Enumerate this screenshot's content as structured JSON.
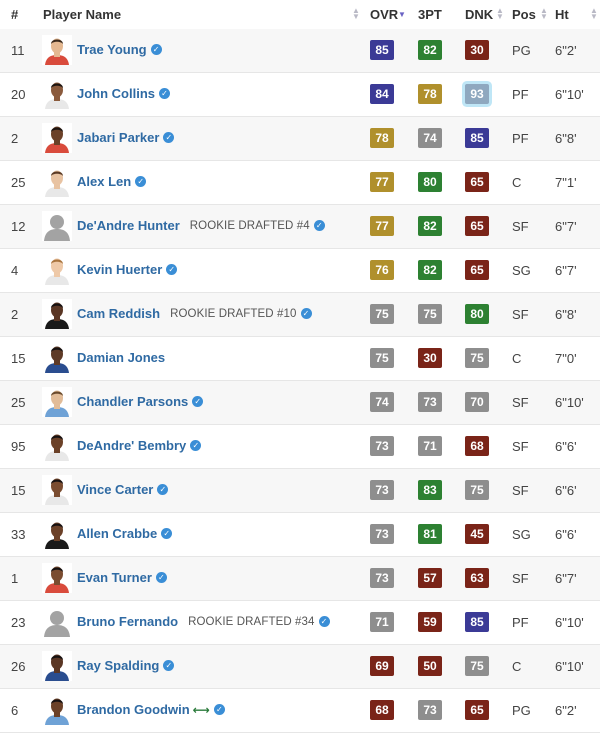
{
  "headers": {
    "num": "#",
    "player": "Player Name",
    "ovr": "OVR",
    "three": "3PT",
    "dnk": "DNK",
    "pos": "Pos",
    "ht": "Ht"
  },
  "colors": {
    "blue": "#3b3a96",
    "green": "#2d8132",
    "gold": "#b0902c",
    "gray": "#8e8e8e",
    "brown": "#7a2418",
    "link": "#2f6aa3"
  },
  "players": [
    {
      "num": "11",
      "name": "Trae Young",
      "rookie": "",
      "ovr": 85,
      "ovr_c": "blue",
      "tpt": 82,
      "tpt_c": "green",
      "dnk": 30,
      "dnk_c": "brown",
      "pos": "PG",
      "ht": "6\"2'",
      "avatar": "photo",
      "skin": "#e4b891",
      "hair": "#3b2a1c",
      "jersey": "#d94b3c",
      "icon": "verified-icon"
    },
    {
      "num": "20",
      "name": "John Collins",
      "rookie": "",
      "ovr": 84,
      "ovr_c": "blue",
      "tpt": 78,
      "tpt_c": "gold",
      "dnk": 93,
      "dnk_c": "hl",
      "pos": "PF",
      "ht": "6\"10'",
      "avatar": "photo",
      "skin": "#8a5a3c",
      "hair": "#1c1410",
      "jersey": "#e8e8e8",
      "icon": "verified-icon"
    },
    {
      "num": "2",
      "name": "Jabari Parker",
      "rookie": "",
      "ovr": 78,
      "ovr_c": "gold",
      "tpt": 74,
      "tpt_c": "gray",
      "dnk": 85,
      "dnk_c": "blue",
      "pos": "PF",
      "ht": "6\"8'",
      "avatar": "photo",
      "skin": "#6b4128",
      "hair": "#1c1410",
      "jersey": "#d94b3c",
      "icon": "verified-icon"
    },
    {
      "num": "25",
      "name": "Alex Len",
      "rookie": "",
      "ovr": 77,
      "ovr_c": "gold",
      "tpt": 80,
      "tpt_c": "green",
      "dnk": 65,
      "dnk_c": "brown",
      "pos": "C",
      "ht": "7\"1'",
      "avatar": "photo",
      "skin": "#e8c3a2",
      "hair": "#5a3a24",
      "jersey": "#e8e8e8",
      "icon": "verified-icon"
    },
    {
      "num": "12",
      "name": "De'Andre Hunter",
      "rookie": "ROOKIE DRAFTED #4",
      "ovr": 77,
      "ovr_c": "gold",
      "tpt": 82,
      "tpt_c": "green",
      "dnk": 65,
      "dnk_c": "brown",
      "pos": "SF",
      "ht": "6\"7'",
      "avatar": "silhouette",
      "skin": "#9a9a9a",
      "hair": "#9a9a9a",
      "jersey": "#9a9a9a",
      "icon": "verified-icon"
    },
    {
      "num": "4",
      "name": "Kevin Huerter",
      "rookie": "",
      "ovr": 76,
      "ovr_c": "gold",
      "tpt": 82,
      "tpt_c": "green",
      "dnk": 65,
      "dnk_c": "brown",
      "pos": "SG",
      "ht": "6\"7'",
      "avatar": "photo",
      "skin": "#eec9a8",
      "hair": "#a8743e",
      "jersey": "#e8e8e8",
      "icon": "verified-icon"
    },
    {
      "num": "2",
      "name": "Cam Reddish",
      "rookie": "ROOKIE DRAFTED #10",
      "ovr": 75,
      "ovr_c": "gray",
      "tpt": 75,
      "tpt_c": "gray",
      "dnk": 80,
      "dnk_c": "green",
      "pos": "SF",
      "ht": "6\"8'",
      "avatar": "photo",
      "skin": "#5a3624",
      "hair": "#151010",
      "jersey": "#1a1a1a",
      "icon": "verified-icon"
    },
    {
      "num": "15",
      "name": "Damian Jones",
      "rookie": "",
      "ovr": 75,
      "ovr_c": "gray",
      "tpt": 30,
      "tpt_c": "brown",
      "dnk": 75,
      "dnk_c": "gray",
      "pos": "C",
      "ht": "7\"0'",
      "avatar": "photo",
      "skin": "#5e3a26",
      "hair": "#151010",
      "jersey": "#2a4d8f",
      "icon": ""
    },
    {
      "num": "25",
      "name": "Chandler Parsons",
      "rookie": "",
      "ovr": 74,
      "ovr_c": "gray",
      "tpt": 73,
      "tpt_c": "gray",
      "dnk": 70,
      "dnk_c": "gray",
      "pos": "SF",
      "ht": "6\"10'",
      "avatar": "photo",
      "skin": "#e2bc98",
      "hair": "#6a4a2c",
      "jersey": "#6fa2d6",
      "icon": "verified-icon"
    },
    {
      "num": "95",
      "name": "DeAndre' Bembry",
      "rookie": "",
      "ovr": 73,
      "ovr_c": "gray",
      "tpt": 71,
      "tpt_c": "gray",
      "dnk": 68,
      "dnk_c": "brown",
      "pos": "SF",
      "ht": "6\"6'",
      "avatar": "photo",
      "skin": "#6b4128",
      "hair": "#151010",
      "jersey": "#e8e8e8",
      "icon": "verified-icon"
    },
    {
      "num": "15",
      "name": "Vince Carter",
      "rookie": "",
      "ovr": 73,
      "ovr_c": "gray",
      "tpt": 83,
      "tpt_c": "green",
      "dnk": 75,
      "dnk_c": "gray",
      "pos": "SF",
      "ht": "6\"6'",
      "avatar": "photo",
      "skin": "#7a4c30",
      "hair": "#151010",
      "jersey": "#e8e8e8",
      "icon": "verified-icon"
    },
    {
      "num": "33",
      "name": "Allen Crabbe",
      "rookie": "",
      "ovr": 73,
      "ovr_c": "gray",
      "tpt": 81,
      "tpt_c": "green",
      "dnk": 45,
      "dnk_c": "brown",
      "pos": "SG",
      "ht": "6\"6'",
      "avatar": "photo",
      "skin": "#6b4128",
      "hair": "#151010",
      "jersey": "#1a1a1a",
      "icon": "verified-icon"
    },
    {
      "num": "1",
      "name": "Evan Turner",
      "rookie": "",
      "ovr": 73,
      "ovr_c": "gray",
      "tpt": 57,
      "tpt_c": "brown",
      "dnk": 63,
      "dnk_c": "brown",
      "pos": "SF",
      "ht": "6\"7'",
      "avatar": "photo",
      "skin": "#7a4c30",
      "hair": "#151010",
      "jersey": "#d94b3c",
      "icon": "verified-icon"
    },
    {
      "num": "23",
      "name": "Bruno Fernando",
      "rookie": "ROOKIE DRAFTED #34",
      "ovr": 71,
      "ovr_c": "gray",
      "tpt": 59,
      "tpt_c": "brown",
      "dnk": 85,
      "dnk_c": "blue",
      "pos": "PF",
      "ht": "6\"10'",
      "avatar": "silhouette",
      "skin": "#9a9a9a",
      "hair": "#9a9a9a",
      "jersey": "#9a9a9a",
      "icon": "verified-icon"
    },
    {
      "num": "26",
      "name": "Ray Spalding",
      "rookie": "",
      "ovr": 69,
      "ovr_c": "brown",
      "tpt": 50,
      "tpt_c": "brown",
      "dnk": 75,
      "dnk_c": "gray",
      "pos": "C",
      "ht": "6\"10'",
      "avatar": "photo",
      "skin": "#5a3624",
      "hair": "#151010",
      "jersey": "#2a4d8f",
      "icon": "verified-icon"
    },
    {
      "num": "6",
      "name": "Brandon Goodwin",
      "rookie": "",
      "ovr": 68,
      "ovr_c": "brown",
      "tpt": 73,
      "tpt_c": "gray",
      "dnk": 65,
      "dnk_c": "brown",
      "pos": "PG",
      "ht": "6\"2'",
      "avatar": "photo",
      "skin": "#6b4128",
      "hair": "#151010",
      "jersey": "#6fa2d6",
      "icon": "verified-icon",
      "extra_icon": "transfer-arrows-icon"
    }
  ]
}
